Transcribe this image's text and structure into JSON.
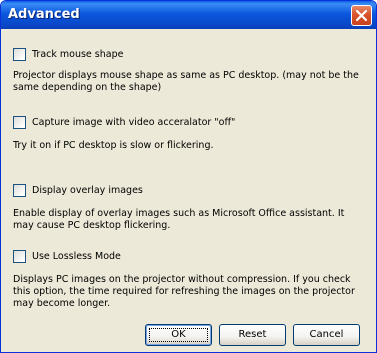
{
  "window": {
    "title": "Advanced",
    "close_icon": "close-icon"
  },
  "options": [
    {
      "label": "Track mouse shape",
      "checked": false,
      "description": "Projector displays mouse shape as same as PC desktop. (may not be the same depending on the shape)"
    },
    {
      "label": "Capture image with video acceralator \"off\"",
      "checked": false,
      "description": "Try it on if PC desktop is slow or flickering."
    },
    {
      "label": "Display overlay images",
      "checked": false,
      "description": "Enable display of overlay images such as Microsoft Office assistant. It may cause PC desktop flickering."
    },
    {
      "label": "Use Lossless Mode",
      "checked": false,
      "description": "Displays PC images on the projector without compression. If you check this option, the time required for refreshing the images on the projector may become longer."
    }
  ],
  "buttons": {
    "ok": "OK",
    "reset": "Reset",
    "cancel": "Cancel"
  },
  "colors": {
    "titlebar": "#0a47c8",
    "dialog_background": "#ece9d8",
    "close_button": "#d9542c"
  }
}
